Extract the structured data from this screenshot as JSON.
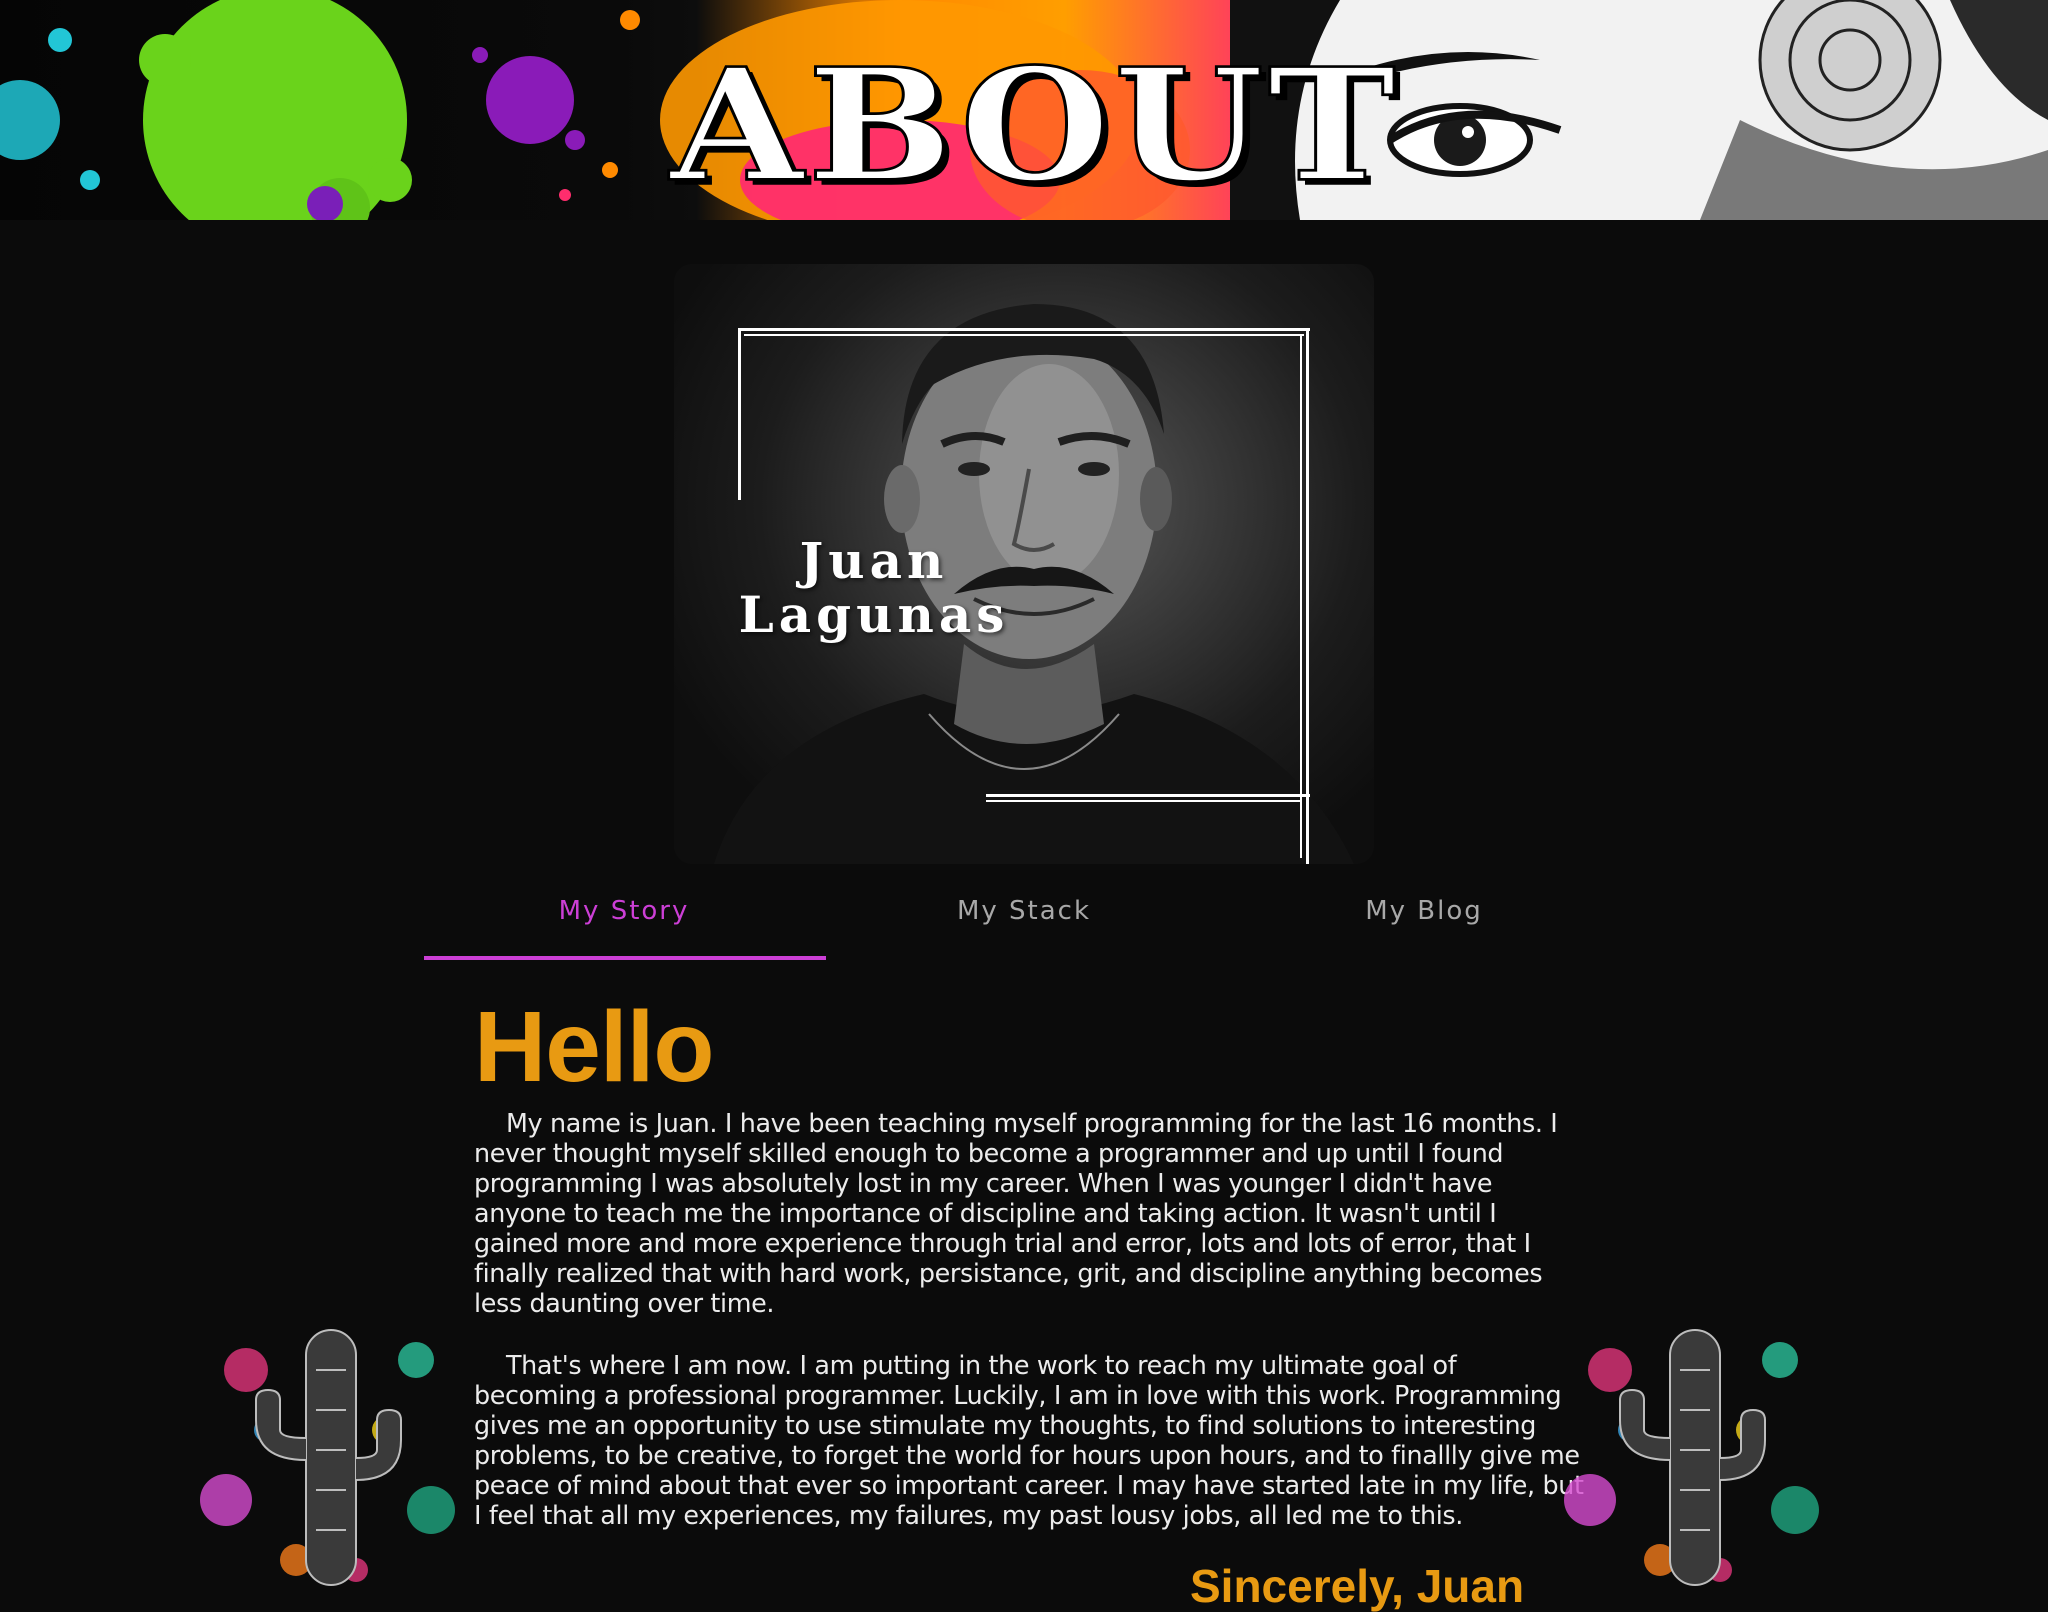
{
  "banner": {
    "title": "ABOUT",
    "colors": {
      "green": "#6ad31b",
      "purple": "#8a1bb8",
      "orange": "#ff8a00",
      "pink": "#ff2d6d"
    }
  },
  "portrait": {
    "name_line1": "Juan",
    "name_line2": "Lagunas",
    "frame_color": "#ffffff"
  },
  "tabs": [
    {
      "label": "My Story",
      "active": true
    },
    {
      "label": "My Stack",
      "active": false
    },
    {
      "label": "My Blog",
      "active": false
    }
  ],
  "content": {
    "heading": "Hello",
    "paragraph_1": "My name is Juan. I have been teaching myself programming for the last 16 months. I never thought myself skilled enough to become a programmer and up until I found programming I was absolutely lost in my career. When I was younger I didn't have anyone to teach me the importance of discipline and taking action. It wasn't until I gained more and more experience through trial and error, lots and lots of error, that I finally realized that with hard work, persistance, grit, and discipline anything becomes less daunting over time.",
    "paragraph_2": "That's where I am now. I am putting in the work to reach my ultimate goal of becoming a professional programmer. Luckily, I am in love with this work. Programming gives me an opportunity to use stimulate my thoughts, to find solutions to interesting problems, to be creative, to forget the world for hours upon hours, and to finallly give me peace of mind about that ever so important career. I may have started late in my life, but I feel that all my experiences, my failures, my past lousy jobs, all led me to this.",
    "signoff": "Sincerely, Juan"
  },
  "theme": {
    "background": "#0b0b0b",
    "accent_purple": "#cc3fd6",
    "accent_orange": "#e89a12",
    "tab_inactive": "#a8a8a8"
  }
}
